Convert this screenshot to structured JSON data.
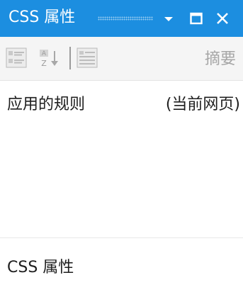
{
  "window": {
    "title": "CSS 属性",
    "accent_color": "#1c8ee0",
    "buttons": {
      "dropdown_icon": "chevron-down-icon",
      "maximize_icon": "maximize-icon",
      "close_icon": "close-icon"
    }
  },
  "toolbar": {
    "icons": [
      "categorized-view-icon",
      "sort-alphabetical-icon",
      "list-view-icon"
    ],
    "summary_label": "摘要"
  },
  "applied_rules": {
    "label": "应用的规则",
    "context": "(当前网页)"
  },
  "css_properties": {
    "label": "CSS 属性"
  }
}
